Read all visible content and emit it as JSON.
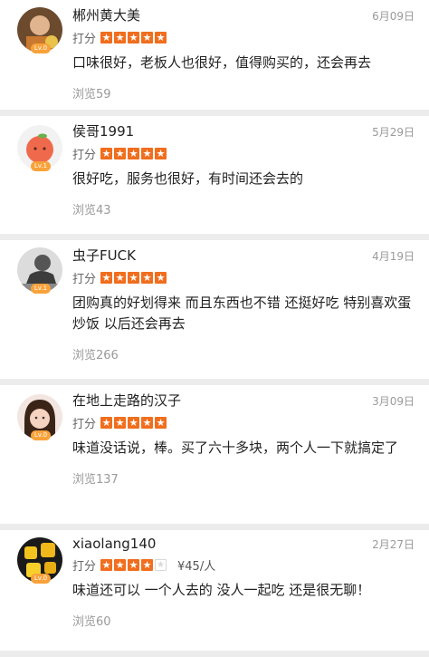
{
  "rating_label": "打分",
  "reviews": [
    {
      "name": "郴州黄大美",
      "date": "6月09日",
      "level": "Lv.0",
      "stars": 5,
      "price": "",
      "content": "口味很好，老板人也很好，值得购买的，还会再去",
      "views": "浏览59"
    },
    {
      "name": "侯哥1991",
      "date": "5月29日",
      "level": "Lv.1",
      "stars": 5,
      "price": "",
      "content": "很好吃，服务也很好，有时间还会去的",
      "views": "浏览43"
    },
    {
      "name": "虫子FUCK",
      "date": "4月19日",
      "level": "Lv.1",
      "stars": 5,
      "price": "",
      "content": "团购真的好划得来 而且东西也不错 还挺好吃 特别喜欢蛋炒饭 以后还会再去",
      "views": "浏览266"
    },
    {
      "name": "在地上走路的汉子",
      "date": "3月09日",
      "level": "Lv.0",
      "stars": 5,
      "price": "",
      "content": "味道没话说，棒。买了六十多块，两个人一下就搞定了",
      "views": "浏览137"
    },
    {
      "name": "xiaolang140",
      "date": "2月27日",
      "level": "Lv.0",
      "stars": 4,
      "price": "¥45/人",
      "content": "味道还可以 一个人去的 没人一起吃 还是很无聊！",
      "views": "浏览60"
    }
  ],
  "colors": {
    "star_on": "#f06e1e",
    "level_badge": "#f8a23a",
    "meta_text": "#9a9a9a"
  }
}
